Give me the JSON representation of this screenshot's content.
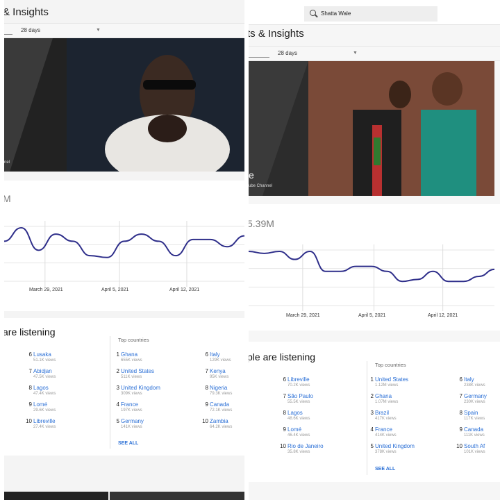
{
  "left": {
    "title": "& Insights",
    "range": "28 days",
    "hero": {
      "channel_label": "nel"
    },
    "metric": "M",
    "x_labels": [
      "March 29, 2021",
      "April 5, 2021",
      "April 12, 2021"
    ],
    "section_title": "are listening",
    "top_countries_header": "Top countries",
    "cities_column": [
      {
        "rank": "6",
        "name": "Lusaka",
        "views": "51.1K views"
      },
      {
        "rank": "7",
        "name": "Abidjan",
        "views": "47.5K views"
      },
      {
        "rank": "8",
        "name": "Lagos",
        "views": "47.4K views"
      },
      {
        "rank": "9",
        "name": "Lomé",
        "views": "29.6K views"
      },
      {
        "rank": "10",
        "name": "Libreville",
        "views": "27.4K views"
      }
    ],
    "countries_col1": [
      {
        "rank": "1",
        "name": "Ghana",
        "views": "655K views"
      },
      {
        "rank": "2",
        "name": "United States",
        "views": "511K views"
      },
      {
        "rank": "3",
        "name": "United Kingdom",
        "views": "309K views"
      },
      {
        "rank": "4",
        "name": "France",
        "views": "197K views"
      },
      {
        "rank": "5",
        "name": "Germany",
        "views": "141K views"
      }
    ],
    "countries_col2": [
      {
        "rank": "6",
        "name": "Italy",
        "views": "129K views"
      },
      {
        "rank": "7",
        "name": "Kenya",
        "views": "95K views"
      },
      {
        "rank": "8",
        "name": "Nigeria",
        "views": "79.3K views"
      },
      {
        "rank": "9",
        "name": "Canada",
        "views": "72.1K views"
      },
      {
        "rank": "10",
        "name": "Zambia",
        "views": "64.2K views"
      }
    ],
    "see_all": "SEE ALL",
    "trend": [
      30,
      45,
      20,
      38,
      30,
      14,
      12,
      30,
      38,
      30,
      14,
      32,
      32,
      24,
      36
    ]
  },
  "right": {
    "search_value": "Shatta Wale",
    "title": "ts & Insights",
    "range": "28 days",
    "hero": {
      "big_text": "e",
      "channel_label": "ube Channel"
    },
    "metric": "5.39M",
    "x_labels": [
      "March 29, 2021",
      "April 5, 2021",
      "April 12, 2021"
    ],
    "section_title": "ple are listening",
    "top_countries_header": "Top countries",
    "cities_column": [
      {
        "rank": "6",
        "name": "Libreville",
        "views": "70.2K views"
      },
      {
        "rank": "7",
        "name": "São Paulo",
        "views": "55.5K views"
      },
      {
        "rank": "8",
        "name": "Lagos",
        "views": "48.6K views"
      },
      {
        "rank": "9",
        "name": "Lomé",
        "views": "46.4K views"
      },
      {
        "rank": "10",
        "name": "Rio de Janeiro",
        "views": "35.8K views"
      }
    ],
    "countries_col1": [
      {
        "rank": "1",
        "name": "United States",
        "views": "1.12M views"
      },
      {
        "rank": "2",
        "name": "Ghana",
        "views": "1.07M views"
      },
      {
        "rank": "3",
        "name": "Brazil",
        "views": "417K views"
      },
      {
        "rank": "4",
        "name": "France",
        "views": "414K views"
      },
      {
        "rank": "5",
        "name": "United Kingdom",
        "views": "378K views"
      }
    ],
    "countries_col2": [
      {
        "rank": "6",
        "name": "Italy",
        "views": "238K views"
      },
      {
        "rank": "7",
        "name": "Germany",
        "views": "230K views"
      },
      {
        "rank": "8",
        "name": "Spain",
        "views": "117K views"
      },
      {
        "rank": "9",
        "name": "Canada",
        "views": "111K views"
      },
      {
        "rank": "10",
        "name": "South Af",
        "views": "101K views"
      }
    ],
    "see_all": "SEE ALL",
    "trend": [
      30,
      28,
      30,
      22,
      30,
      10,
      10,
      15,
      15,
      10,
      0,
      2,
      10,
      0,
      0,
      5,
      12
    ]
  },
  "colors": {
    "line": "#2e2e8a",
    "link": "#2a6fd6"
  }
}
